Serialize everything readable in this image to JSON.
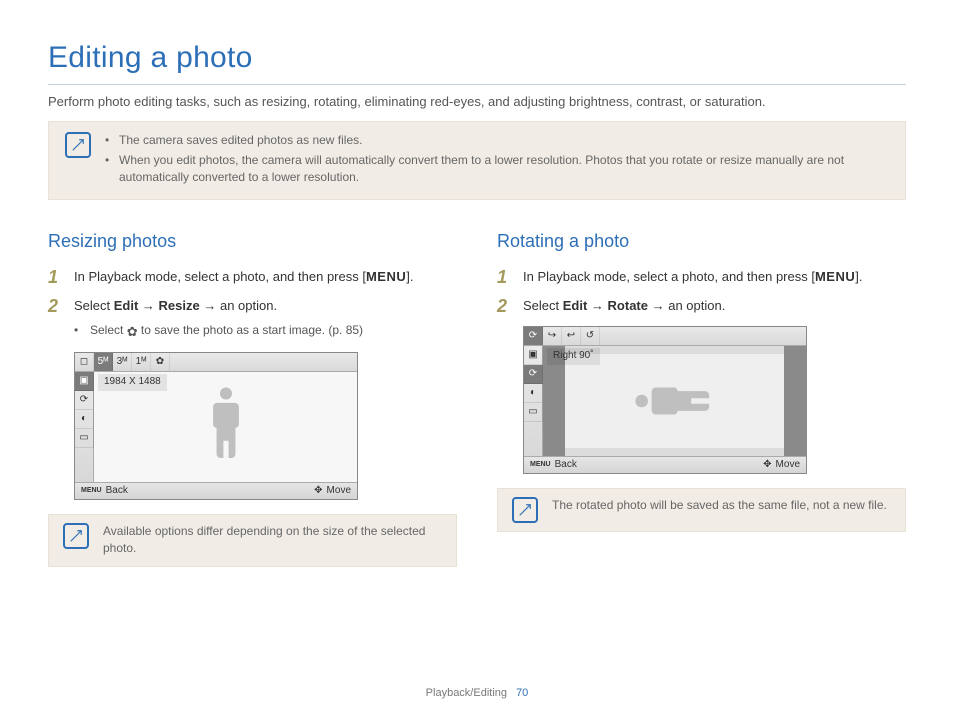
{
  "title": "Editing a photo",
  "intro": "Perform photo editing tasks, such as resizing, rotating, eliminating red-eyes, and adjusting brightness, contrast, or saturation.",
  "top_notes": [
    "The camera saves edited photos as new files.",
    "When you edit photos, the camera will automatically convert them to a lower resolution. Photos that you rotate or resize manually are not automatically converted to a lower resolution."
  ],
  "left": {
    "heading": "Resizing photos",
    "step1": "In Playback mode, select a photo, and then press",
    "menu_key": "MENU",
    "step2_prefix": "Select ",
    "step2_edit": "Edit",
    "step2_arrow": " → ",
    "step2_cmd": "Resize",
    "step2_suffix": " → an option.",
    "sub_bullet_prefix": "Select ",
    "sub_bullet_icon": "start-image-icon",
    "sub_bullet_suffix": " to save the photo as a start image. (p. 85)",
    "ss": {
      "top_icons": [
        "◻",
        "5ᴹ",
        "3ᴹ",
        "1ᴹ",
        "✿"
      ],
      "label": "1984 X 1488",
      "left_icons": [
        "▣",
        "⟳",
        "◐",
        "▭"
      ],
      "bottom_left_icon": "MENU",
      "bottom_left": "Back",
      "bottom_right_icon": "✥",
      "bottom_right": "Move"
    },
    "note": "Available options differ depending on the size of the selected photo."
  },
  "right": {
    "heading": "Rotating a photo",
    "step1": "In Playback mode, select a photo, and then press",
    "menu_key": "MENU",
    "step2_prefix": "Select ",
    "step2_edit": "Edit",
    "step2_arrow": " → ",
    "step2_cmd": "Rotate",
    "step2_suffix": " → an option.",
    "ss": {
      "top_icons": [
        "⟳",
        "↪",
        "↩",
        "↺"
      ],
      "label": "Right 90˚",
      "left_icons": [
        "▣",
        "⟳",
        "◐",
        "▭"
      ],
      "bottom_left_icon": "MENU",
      "bottom_left": "Back",
      "bottom_right_icon": "✥",
      "bottom_right": "Move"
    },
    "note": "The rotated photo will be saved as the same file, not a new file."
  },
  "footer_section": "Playback/Editing",
  "footer_page": "70"
}
